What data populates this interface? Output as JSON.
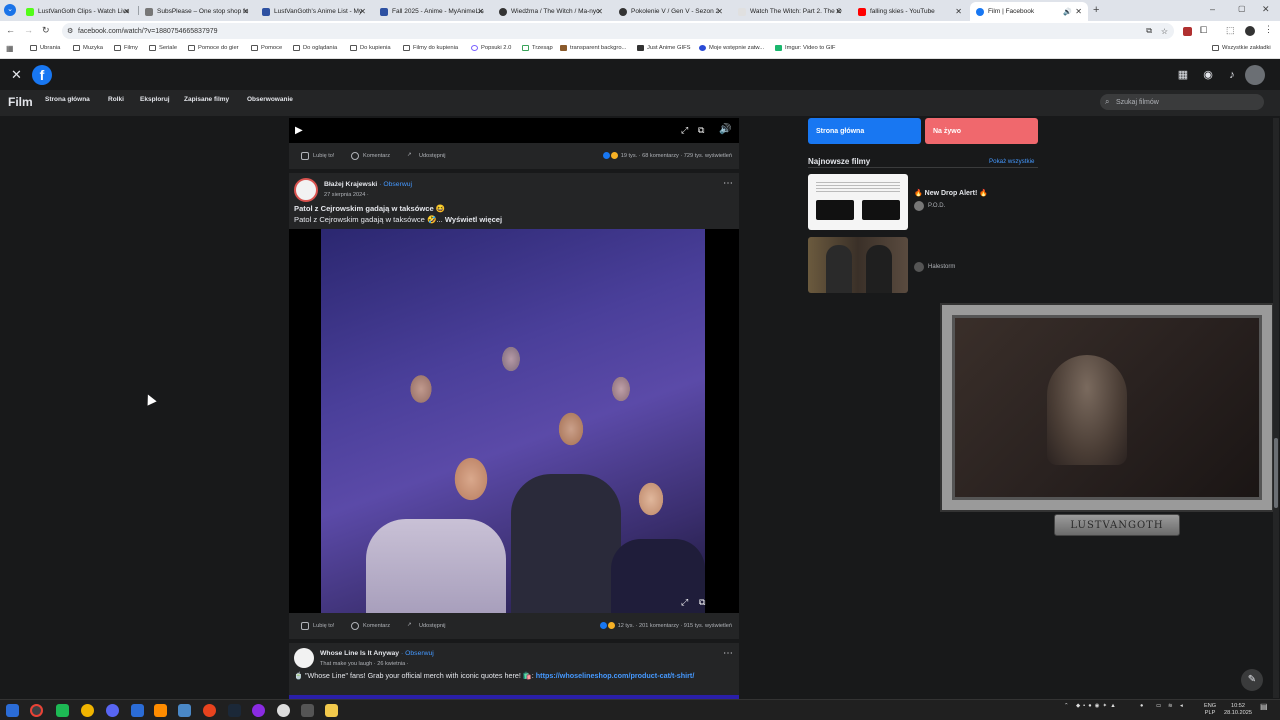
{
  "browser": {
    "tabs": [
      {
        "title": "LustVanGoth Clips - Watch Live",
        "color": "#53fc18"
      },
      {
        "title": "SubsPlease – One stop shop fo",
        "color": "#777777"
      },
      {
        "title": "LustVanGoth's Anime List - My",
        "color": "#2e51a2"
      },
      {
        "title": "Fall 2025 - Anime - MyAnimeLis",
        "color": "#2e51a2"
      },
      {
        "title": "Wiedźma / The Witch / Ma-nyo",
        "color": "#333333"
      },
      {
        "title": "Pokolenie V / Gen V - Sezon 2",
        "color": "#333333"
      },
      {
        "title": "Watch The Witch: Part 2. The O",
        "color": "#e0e0e0"
      },
      {
        "title": "falling skies - YouTube",
        "color": "#ff0000"
      },
      {
        "title": "Film | Facebook",
        "color": "#1877f2"
      }
    ],
    "url": "facebook.com/watch/?v=1880754665837979",
    "bookmarks": [
      "Ubrania",
      "Muzyka",
      "Filmy",
      "Seriale",
      "Pomoce do gier",
      "Pomoce",
      "Do oglądania",
      "Do kupienia",
      "Filmy do kupienia",
      "Popsuki 2.0",
      "Trzesąp",
      "transparent backgro...",
      "Just Anime GIFS",
      "Moje wstępnie zatw...",
      "Imgur: Video to GIF"
    ],
    "all_bookmarks": "Wszystkie zakładki"
  },
  "fb": {
    "section_title": "Film",
    "nav": [
      "Strona główna",
      "Rolki",
      "Eksploruj",
      "Zapisane filmy",
      "Obserwowanie"
    ],
    "search_placeholder": "Szukaj filmów"
  },
  "post1": {
    "actions": {
      "like": "Lubię to!",
      "comment": "Komentarz",
      "share": "Udostępnij"
    },
    "stats": "19 tys. · 68 komentarzy · 729 tys. wyświetleń"
  },
  "post2": {
    "author": "Błażej Krajewski",
    "follow": "· Obserwuj",
    "date": "27 sierpnia 2024 ·",
    "title": "Patol z Cejrowskim gadają w taksówce 😆",
    "text": "Patol z Cejrowskim gadają w taksówce 🤣...",
    "see_more": "Wyświetl więcej",
    "actions": {
      "like": "Lubię to!",
      "comment": "Komentarz",
      "share": "Udostępnij"
    },
    "stats": "12 tys. · 201 komentarzy · 915 tys. wyświetleń"
  },
  "post3": {
    "author": "Whose Line Is It Anyway",
    "follow": "· Obserwuj",
    "subtitle": "That make you laugh · 26 kwietnia ·",
    "text": "🍵 \"Whose Line\" fans! Grab your official merch with iconic quotes here! 🛍️:",
    "link": "https://whoselineshop.com/product-cat/t-shirt/"
  },
  "sidebar": {
    "home_button": "Strona główna",
    "live_button": "Na żywo",
    "newest_title": "Najnowsze filmy",
    "show_all": "Pokaż wszystkie",
    "videos": [
      {
        "title": "🔥 New Drop Alert! 🔥",
        "channel": "P.O.D."
      },
      {
        "title": "",
        "channel": "Halestorm"
      }
    ]
  },
  "overlay": {
    "plate": "LUSTVANGOTH"
  },
  "taskbar": {
    "lang": "ENG",
    "lang2": "PLP",
    "time": "10:52",
    "date": "28.10.2025"
  },
  "colors": {
    "fb_blue": "#1877f2",
    "live_red": "#f0686d",
    "link": "#4599ff"
  }
}
